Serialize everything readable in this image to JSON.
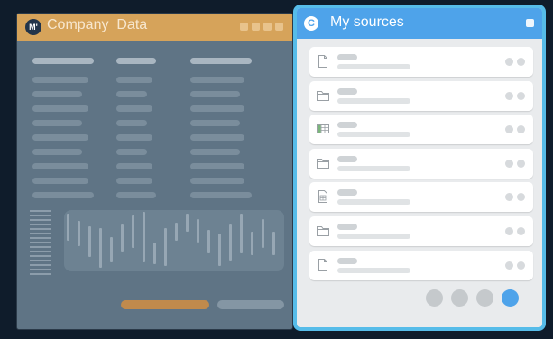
{
  "background_window": {
    "logo": "M'",
    "title": "Company  Data",
    "title_color": "#f7e7cf",
    "titlebar_color": "#d6a35a"
  },
  "panel": {
    "title": "My sources",
    "accent_color": "#4ea3ea",
    "border_color": "#56bce9",
    "logo_icon": "copyright-c-icon",
    "sources": [
      {
        "icon": "file-icon"
      },
      {
        "icon": "folder-icon"
      },
      {
        "icon": "spreadsheet-icon"
      },
      {
        "icon": "folder-icon"
      },
      {
        "icon": "document-table-icon"
      },
      {
        "icon": "folder-icon"
      },
      {
        "icon": "file-icon"
      }
    ],
    "pagination": {
      "pages": 4,
      "current": 4
    }
  }
}
